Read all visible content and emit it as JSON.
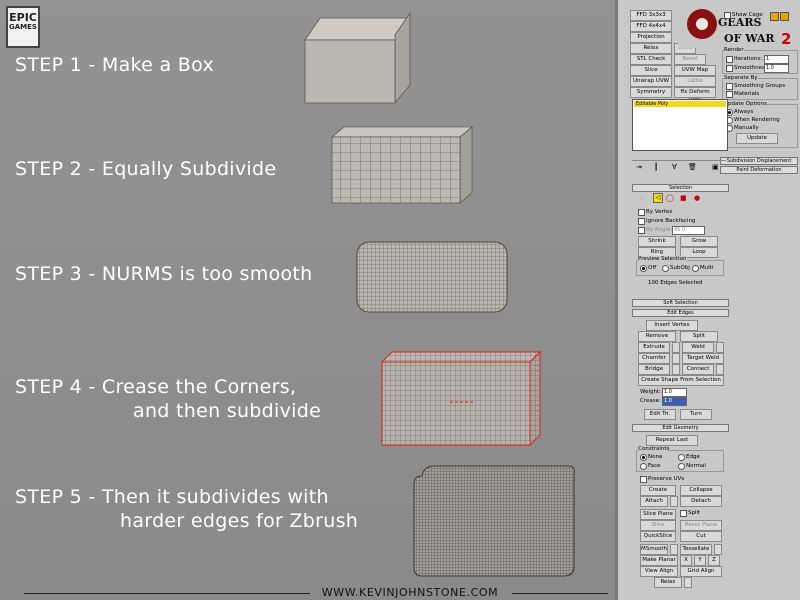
{
  "logos": {
    "epic_top": "EPIC",
    "epic_bottom": "GAMES",
    "gow_top": "GEARS",
    "gow_mid": "OF WAR",
    "gow_num": "2"
  },
  "steps": [
    {
      "line1": "STEP 1 - Make a Box",
      "line2": ""
    },
    {
      "line1": "STEP 2 - Equally Subdivide",
      "line2": ""
    },
    {
      "line1": "STEP 3 - NURMS is too smooth",
      "line2": ""
    },
    {
      "line1": "STEP 4 - Crease the Corners,",
      "line2": "and then subdivide"
    },
    {
      "line1": "STEP 5 - Then it subdivides with",
      "line2": "harder edges for Zbrush"
    }
  ],
  "footer": "WWW.KEVINJOHNSTONE.COM",
  "panel": {
    "modifier_buttons": [
      "FFD 3x3x3",
      "FFD 4x4x4",
      "Projection",
      "Relax",
      "Bend",
      "STL Check",
      "Bevel",
      "Slice",
      "UVW Map",
      "Unwrap UVW",
      "Lathe",
      "Symmetry",
      "ffx Deform (WS)"
    ],
    "stack_item": "Editable Poly",
    "subdiv": {
      "show_cage": "Show Cage",
      "render": "Render",
      "iterations": "Iterations:",
      "iterations_val": "1",
      "smoothness": "Smoothness:",
      "smoothness_val": "1.0",
      "separate_by": "Separate By",
      "smoothing_groups": "Smoothing Groups",
      "materials": "Materials",
      "update_options": "Update Options",
      "always": "Always",
      "when_rendering": "When Rendering",
      "manually": "Manually",
      "update": "Update"
    },
    "rollouts": {
      "subdivision_displacement": "Subdivision Displacement",
      "paint_deformation": "Paint Deformation",
      "selection": "Selection",
      "soft_selection": "Soft Selection",
      "edit_edges": "Edit Edges",
      "edit_geometry": "Edit Geometry"
    },
    "selection": {
      "by_vertex": "By Vertex",
      "ignore_backfacing": "Ignore Backfacing",
      "by_angle": "By Angle:",
      "by_angle_val": "45.0",
      "shrink": "Shrink",
      "grow": "Grow",
      "ring": "Ring",
      "loop": "Loop",
      "preview_selection": "Preview Selection",
      "off": "Off",
      "subobj": "SubObj",
      "multi": "Multi",
      "status": "100 Edges Selected"
    },
    "edit_edges": {
      "insert_vertex": "Insert Vertex",
      "remove": "Remove",
      "split": "Split",
      "extrude": "Extrude",
      "weld": "Weld",
      "chamfer": "Chamfer",
      "target_weld": "Target Weld",
      "bridge": "Bridge",
      "connect": "Connect",
      "create_shape": "Create Shape From Selection",
      "weight": "Weight:",
      "weight_val": "1.0",
      "crease": "Crease:",
      "crease_val": "1.0",
      "edit_tri": "Edit Tri.",
      "turn": "Turn"
    },
    "edit_geometry": {
      "repeat_last": "Repeat Last",
      "constraints": "Constraints",
      "none": "None",
      "edge": "Edge",
      "face": "Face",
      "normal": "Normal",
      "preserve_uvs": "Preserve UVs",
      "create": "Create",
      "collapse": "Collapse",
      "attach": "Attach",
      "detach": "Detach",
      "slice_plane": "Slice Plane",
      "split": "Split",
      "slice": "Slice",
      "reset_plane": "Reset Plane",
      "quickslice": "QuickSlice",
      "cut": "Cut",
      "msmooth": "MSmooth",
      "tessellate": "Tessellate",
      "make_planar": "Make Planar",
      "x": "X",
      "y": "Y",
      "z": "Z",
      "view_align": "View Align",
      "grid_align": "Grid Align",
      "relax": "Relax"
    }
  }
}
